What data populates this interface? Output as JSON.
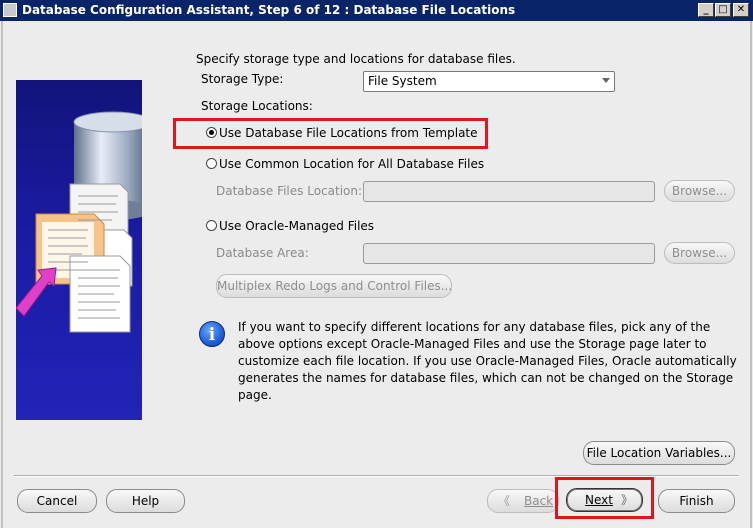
{
  "window": {
    "title": "Database Configuration Assistant, Step 6 of 12 : Database File Locations",
    "controls": [
      "_",
      "□",
      "✕"
    ]
  },
  "form": {
    "intro": "Specify storage type and locations for database files.",
    "storage_type_label": "Storage Type:",
    "storage_type_value": "File System",
    "storage_locations_label": "Storage Locations:",
    "options": [
      {
        "label": "Use Database File Locations from Template",
        "selected": true
      },
      {
        "label": "Use Common Location for All Database Files",
        "selected": false
      },
      {
        "label": "Use Oracle-Managed Files",
        "selected": false
      }
    ],
    "db_files_location_label": "Database Files Location:",
    "db_files_location_value": "",
    "database_area_label": "Database Area:",
    "database_area_value": "",
    "browse_label": "Browse...",
    "multiplex_label": "Multiplex Redo Logs and Control Files...",
    "info_text": "If you want to specify different locations for any database files, pick any of the above options except Oracle-Managed Files and use the Storage page later to customize each file location. If you use Oracle-Managed Files, Oracle automatically generates the names for database files, which can not be changed on the Storage page.",
    "file_location_variables_label": "File Location Variables..."
  },
  "footer": {
    "cancel": "Cancel",
    "help": "Help",
    "back": "Back",
    "next": "Next",
    "finish": "Finish"
  },
  "colors": {
    "titlebar": "#0a246a",
    "highlight": "#e0161c",
    "illustration": "#1a1aa0"
  }
}
